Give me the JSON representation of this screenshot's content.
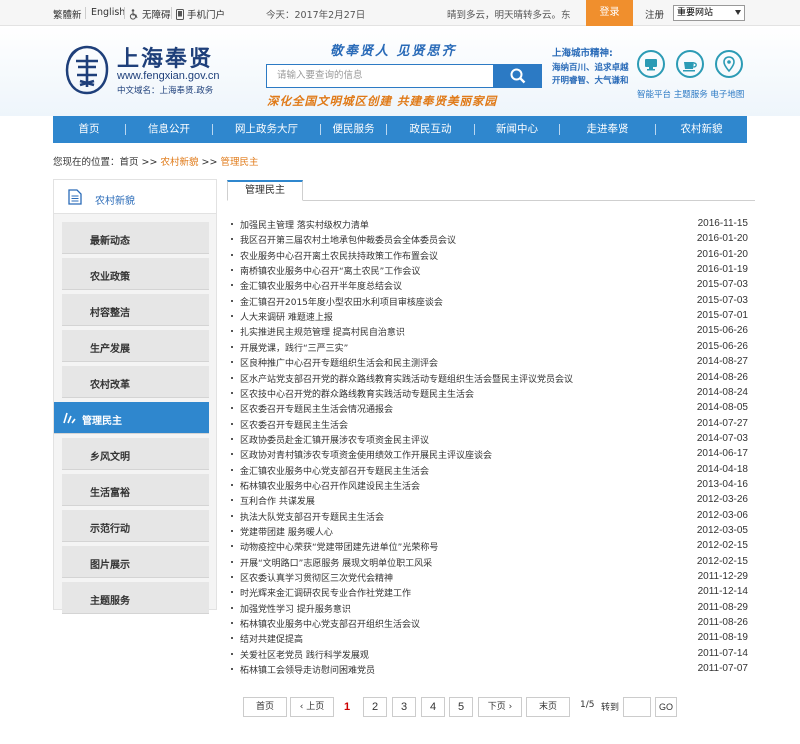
{
  "topbar": {
    "traditional": "繁體新",
    "english": "English",
    "accessibility": "无障碍",
    "mobile": "手机门户",
    "date": "今天：2017年2月27日",
    "weather": "晴到多云，明天晴转多云。东",
    "login": "登录",
    "register": "注册",
    "site_select": "重要网站"
  },
  "header": {
    "title": "上海奉贤",
    "url": "www.fengxian.gov.cn",
    "cn_domain": "中文域名：上海奉贤.政务",
    "slogan_top": "敬奉贤人  见贤思齐",
    "slogan_bottom": "深化全国文明城区创建  共建奉贤美丽家园",
    "search_placeholder": "请输入要查询的信息",
    "city_spirit_title": "上海城市精神:",
    "city_spirit_line1": "海纳百川、追求卓越",
    "city_spirit_line2": "开明睿智、大气谦和",
    "icon_labels": "智能平台 主题服务 电子地图"
  },
  "nav": [
    "首页",
    "信息公开",
    "网上政务大厅",
    "便民服务",
    "政民互动",
    "新闻中心",
    "走进奉贤",
    "农村新貌"
  ],
  "breadcrumb": {
    "prefix": "您现在的位置：首页 >>",
    "level1": "农村新貌",
    "sep": ">>",
    "level2": "管理民主"
  },
  "sidebar": {
    "heading": "农村新貌",
    "items": [
      "最新动态",
      "农业政策",
      "村容整洁",
      "生产发展",
      "农村改革",
      "管理民主",
      "乡风文明",
      "生活富裕",
      "示范行动",
      "图片展示",
      "主题服务"
    ],
    "active_index": 5
  },
  "main": {
    "tab": "管理民主",
    "articles": [
      {
        "title": "加强民主管理 落实村级权力清单",
        "date": "2016-11-15"
      },
      {
        "title": "我区召开第三届农村土地承包仲裁委员会全体委员会议",
        "date": "2016-01-20"
      },
      {
        "title": "农业服务中心召开离土农民扶持政策工作布置会议",
        "date": "2016-01-20"
      },
      {
        "title": "南桥镇农业服务中心召开“离土农民”工作会议",
        "date": "2016-01-19"
      },
      {
        "title": "金汇镇农业服务中心召开半年度总结会议",
        "date": "2015-07-03"
      },
      {
        "title": "金汇镇召开2015年度小型农田水利项目审核座谈会",
        "date": "2015-07-03"
      },
      {
        "title": "人大来调研 难题速上报",
        "date": "2015-07-01"
      },
      {
        "title": "扎实推进民主规范管理   提高村民自治意识",
        "date": "2015-06-26"
      },
      {
        "title": "开展党课，践行“三严三实”",
        "date": "2015-06-26"
      },
      {
        "title": "区良种推广中心召开专题组织生活会和民主测评会",
        "date": "2014-08-27"
      },
      {
        "title": "区水产站党支部召开党的群众路线教育实践活动专题组织生活会暨民主评议党员会议",
        "date": "2014-08-26"
      },
      {
        "title": "区农技中心召开党的群众路线教育实践活动专题民主生活会",
        "date": "2014-08-24"
      },
      {
        "title": "区农委召开专题民主生活会情况通报会",
        "date": "2014-08-05"
      },
      {
        "title": "区农委召开专题民主生活会",
        "date": "2014-07-27"
      },
      {
        "title": "区政协委员赴金汇镇开展涉农专项资金民主评议",
        "date": "2014-07-03"
      },
      {
        "title": "区政协对青村镇涉农专项资金使用绩效工作开展民主评议座谈会",
        "date": "2014-06-17"
      },
      {
        "title": "金汇镇农业服务中心党支部召开专题民主生活会",
        "date": "2014-04-18"
      },
      {
        "title": "柘林镇农业服务中心召开作风建设民主生活会",
        "date": "2013-04-16"
      },
      {
        "title": "互利合作 共谋发展",
        "date": "2012-03-26"
      },
      {
        "title": "执法大队党支部召开专题民主生活会",
        "date": "2012-03-06"
      },
      {
        "title": "党建带团建 服务暖人心",
        "date": "2012-03-05"
      },
      {
        "title": "动物疫控中心荣获“党建带团建先进单位”光荣称号",
        "date": "2012-02-15"
      },
      {
        "title": "开展“文明路口”志愿服务 展现文明单位职工风采",
        "date": "2012-02-15"
      },
      {
        "title": "区农委认真学习贯彻区三次党代会精神",
        "date": "2011-12-29"
      },
      {
        "title": "时光辉来金汇调研农民专业合作社党建工作",
        "date": "2011-12-14"
      },
      {
        "title": "加强党性学习 提升服务意识",
        "date": "2011-08-29"
      },
      {
        "title": "柘林镇农业服务中心党支部召开组织生活会议",
        "date": "2011-08-26"
      },
      {
        "title": "结对共建促提高",
        "date": "2011-08-19"
      },
      {
        "title": "关爱社区老党员 践行科学发展观",
        "date": "2011-07-14"
      },
      {
        "title": "柘林镇工会领导走访慰问困难党员",
        "date": "2011-07-07"
      }
    ]
  },
  "pager": {
    "first": "首页",
    "prev": "上页",
    "pages": [
      "1",
      "2",
      "3",
      "4",
      "5"
    ],
    "current": "1",
    "next": "下页",
    "last": "末页",
    "status": "1/5",
    "goto_label": "转到",
    "go": "GO"
  }
}
